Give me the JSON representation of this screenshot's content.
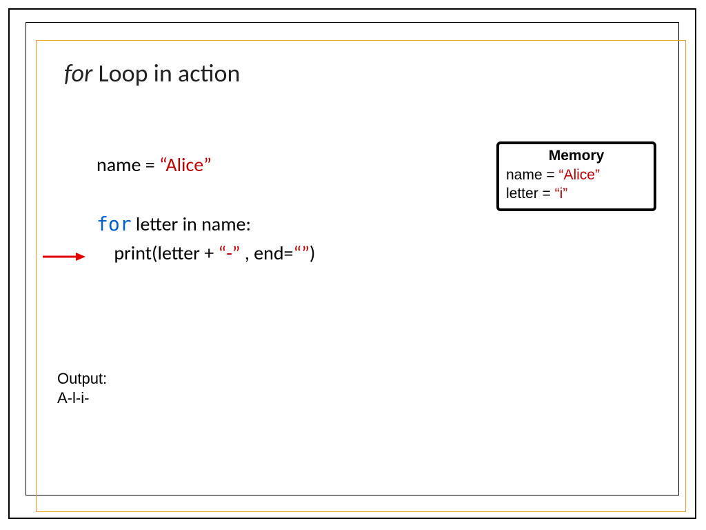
{
  "title": {
    "keyword": "for",
    "rest": " Loop in action"
  },
  "code": {
    "line1": {
      "pre": "name = ",
      "str": "“Alice”"
    },
    "line2": {
      "kw": "for",
      "rest": " letter in name:"
    },
    "line3": {
      "indent": "    print(letter + ",
      "str1": "“-”",
      "mid": " , end=",
      "str2": "“”",
      "close": ")"
    }
  },
  "memory": {
    "title": "Memory",
    "row1": {
      "label": "name = ",
      "value": "“Alice”"
    },
    "row2": {
      "label": "letter = ",
      "value": "“i”"
    }
  },
  "output": {
    "label": "Output:",
    "value": "A-l-i-"
  }
}
